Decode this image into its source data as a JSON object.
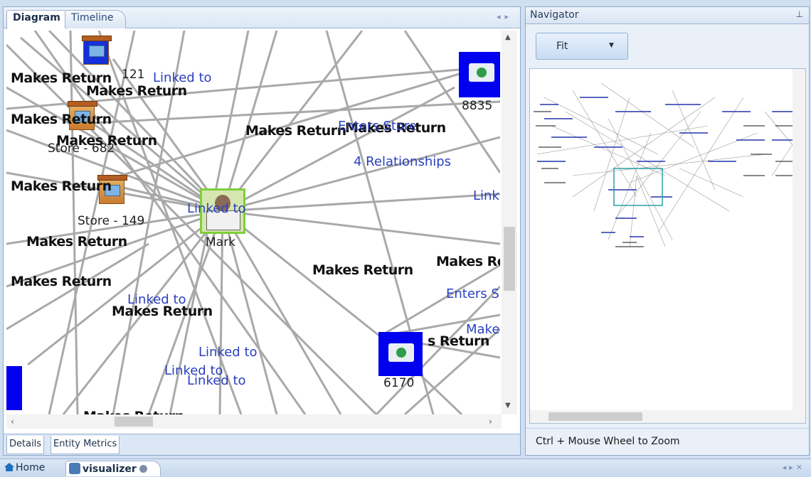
{
  "tabs": {
    "diagram": "Diagram",
    "timeline": "Timeline"
  },
  "graph": {
    "relationship_labels": [
      "Makes Return",
      "Makes Return",
      "Makes Return",
      "Makes Return",
      "Makes Return",
      "Makes Return",
      "Makes Return",
      "Makes Return",
      "Makes Return",
      "Makes Return",
      "Makes Re",
      "Makes Return",
      "Makes Re",
      "s Return",
      "Makes Return",
      "Makes Return"
    ],
    "link_labels": [
      "Linked to",
      "Linked to",
      "Linked to",
      "Linked to",
      "Linked to",
      "Linked to",
      "Linke",
      "Link",
      "Enters S",
      "Enters Store",
      "Make"
    ],
    "summary_label": "4 Relationships",
    "nodes": {
      "store_149": "Store - 149",
      "store_682": "Store - 682",
      "store_121": "121",
      "person": "Mark",
      "n8835": "8835",
      "n6170": "6170"
    }
  },
  "bottom_tabs": {
    "details": "Details",
    "entity_metrics": "Entity Metrics"
  },
  "navigator": {
    "title": "Navigator",
    "fit_label": "Fit",
    "hint": "Ctrl + Mouse Wheel to Zoom"
  },
  "doc_tabs": {
    "home": "Home",
    "visualizer": "visualizer"
  }
}
